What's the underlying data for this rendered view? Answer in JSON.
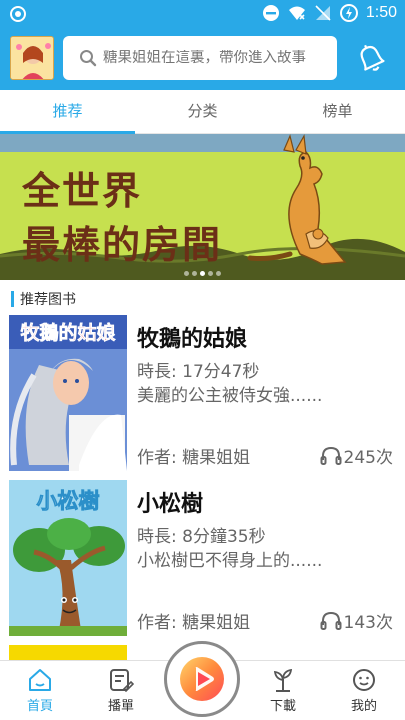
{
  "status_bar": {
    "time": "1:50"
  },
  "header": {
    "search_placeholder": "糖果姐姐在這裏，帶你進入故事"
  },
  "tabs": [
    {
      "label": "推荐"
    },
    {
      "label": "分类"
    },
    {
      "label": "榜单"
    }
  ],
  "banner": {
    "title_line1": "全世界",
    "title_line2": "最棒的房間",
    "slide_count": 5,
    "active_slide": 3
  },
  "section": {
    "title": "推荐图书"
  },
  "books": [
    {
      "cover_text": "牧鵝的姑娘",
      "name": "牧鵝的姑娘",
      "duration": "時長: 17分47秒",
      "desc": "美麗的公主被侍女強......",
      "author": "作者:  糖果姐姐",
      "plays": "245次"
    },
    {
      "cover_text": "小松樹",
      "name": "小松樹",
      "duration": "時長: 8分鐘35秒",
      "desc": "小松樹巴不得身上的......",
      "author": "作者:  糖果姐姐",
      "plays": "143次"
    }
  ],
  "bottom_nav": [
    {
      "label": "首頁",
      "icon": "home-icon"
    },
    {
      "label": "播單",
      "icon": "playlist-icon"
    },
    {
      "label": "下載",
      "icon": "download-sprout-icon"
    },
    {
      "label": "我的",
      "icon": "profile-icon"
    }
  ],
  "colors": {
    "accent": "#29a9e7",
    "banner_bg": "#c6e04f",
    "banner_text": "#6b2f17",
    "play_gradient_start": "#ffd66a",
    "play_gradient_end": "#ff4a55"
  }
}
